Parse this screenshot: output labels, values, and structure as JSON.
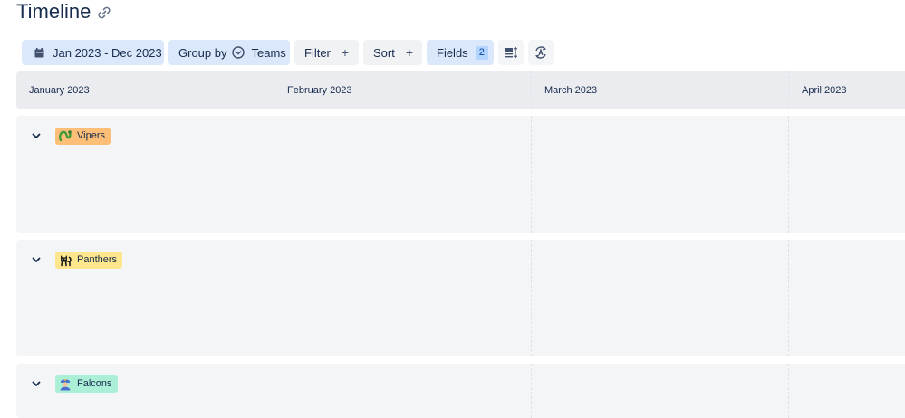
{
  "page": {
    "title": "Timeline"
  },
  "toolbar": {
    "date_range": "Jan 2023 - Dec 2023",
    "group_by_label": "Group by",
    "group_by_value": "Teams",
    "filter_label": "Filter",
    "sort_label": "Sort",
    "fields_label": "Fields",
    "fields_count": "2",
    "plus": "+"
  },
  "timeline": {
    "months": [
      "January 2023",
      "February 2023",
      "March 2023",
      "April 2023"
    ]
  },
  "lanes": [
    {
      "name": "Vipers",
      "color": "#fdbf78",
      "icon": "snake-icon"
    },
    {
      "name": "Panthers",
      "color": "#fde68c",
      "icon": "cat-icon"
    },
    {
      "name": "Falcons",
      "color": "#abefd6",
      "icon": "pilot-icon"
    }
  ]
}
